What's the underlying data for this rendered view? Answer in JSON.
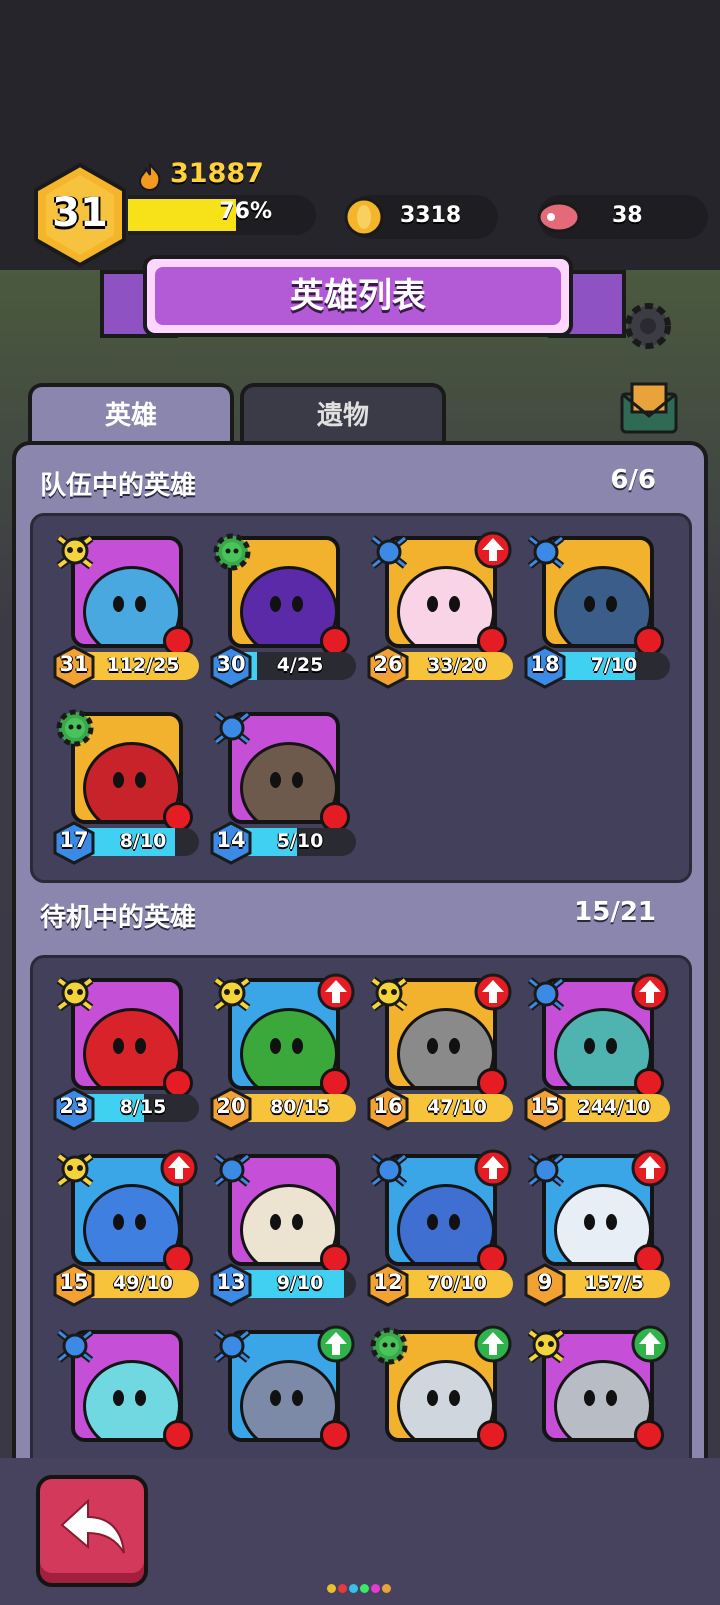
{
  "player": {
    "level": "31",
    "power": "31887",
    "xp_percent": 76,
    "xp_text": "76%"
  },
  "resources": {
    "coins": "3318",
    "meat": "38"
  },
  "banner": {
    "title": "英雄列表"
  },
  "tabs": [
    {
      "label": "英雄",
      "active": true
    },
    {
      "label": "遗物",
      "active": false
    }
  ],
  "team": {
    "title": "队伍中的英雄",
    "count": "6/6",
    "heroes": [
      {
        "level": "31",
        "shards": "112/25",
        "class": "skull",
        "upgrade": false,
        "bg": "#c64fd8",
        "body": "#4aa8e0",
        "bar": "gold",
        "fill": 1.0,
        "lvcolor": "gold"
      },
      {
        "level": "30",
        "shards": "4/25",
        "class": "gear",
        "upgrade": false,
        "bg": "#f3b22e",
        "body": "#5b2aa8",
        "bar": "cyan",
        "fill": 0.16,
        "lvcolor": "blue"
      },
      {
        "level": "26",
        "shards": "33/20",
        "class": "bug",
        "upgrade": true,
        "bg": "#f3b22e",
        "body": "#f9d4e6",
        "bar": "gold",
        "fill": 1.0,
        "lvcolor": "gold"
      },
      {
        "level": "18",
        "shards": "7/10",
        "class": "bug",
        "upgrade": false,
        "bg": "#f3b22e",
        "body": "#3b5d8a",
        "bar": "cyan",
        "fill": 0.7,
        "lvcolor": "blue"
      },
      {
        "level": "17",
        "shards": "8/10",
        "class": "gear",
        "upgrade": false,
        "bg": "#f3b22e",
        "body": "#c8232a",
        "bar": "cyan",
        "fill": 0.8,
        "lvcolor": "blue"
      },
      {
        "level": "14",
        "shards": "5/10",
        "class": "bug",
        "upgrade": false,
        "bg": "#c64fd8",
        "body": "#6e5a4c",
        "bar": "cyan",
        "fill": 0.5,
        "lvcolor": "blue"
      }
    ]
  },
  "bench": {
    "title": "待机中的英雄",
    "count": "15/21",
    "heroes": [
      {
        "level": "23",
        "shards": "8/15",
        "class": "skull",
        "upgrade": false,
        "bg": "#c64fd8",
        "body": "#d8232a",
        "bar": "cyan",
        "fill": 0.53,
        "lvcolor": "blue"
      },
      {
        "level": "20",
        "shards": "80/15",
        "class": "skull",
        "upgrade": true,
        "bg": "#3aa6e8",
        "body": "#3aa83a",
        "bar": "gold",
        "fill": 1.0,
        "lvcolor": "gold"
      },
      {
        "level": "16",
        "shards": "47/10",
        "class": "skull",
        "upgrade": true,
        "bg": "#f3b22e",
        "body": "#8a8a8a",
        "bar": "gold",
        "fill": 1.0,
        "lvcolor": "gold"
      },
      {
        "level": "15",
        "shards": "244/10",
        "class": "bug",
        "upgrade": true,
        "bg": "#c64fd8",
        "body": "#4fb3b0",
        "bar": "gold",
        "fill": 1.0,
        "lvcolor": "gold"
      },
      {
        "level": "15",
        "shards": "49/10",
        "class": "skull",
        "upgrade": true,
        "bg": "#3aa6e8",
        "body": "#3f7fe0",
        "bar": "gold",
        "fill": 1.0,
        "lvcolor": "gold"
      },
      {
        "level": "13",
        "shards": "9/10",
        "class": "bug",
        "upgrade": false,
        "bg": "#c64fd8",
        "body": "#ece3d0",
        "bar": "cyan",
        "fill": 0.9,
        "lvcolor": "blue"
      },
      {
        "level": "12",
        "shards": "70/10",
        "class": "bug",
        "upgrade": true,
        "bg": "#3aa6e8",
        "body": "#3f6fd0",
        "bar": "gold",
        "fill": 1.0,
        "lvcolor": "gold"
      },
      {
        "level": "9",
        "shards": "157/5",
        "class": "bug",
        "upgrade": true,
        "bg": "#3aa6e8",
        "body": "#e8eef5",
        "bar": "gold",
        "fill": 1.0,
        "lvcolor": "gold"
      },
      {
        "level": "",
        "shards": "",
        "class": "bug",
        "upgrade": false,
        "bg": "#c64fd8",
        "body": "#6fd8e0",
        "bar": "none",
        "fill": 0,
        "lvcolor": "blue"
      },
      {
        "level": "",
        "shards": "",
        "class": "bug",
        "upgrade": "green",
        "bg": "#3aa6e8",
        "body": "#7c8aa8",
        "bar": "none",
        "fill": 0,
        "lvcolor": "blue"
      },
      {
        "level": "",
        "shards": "",
        "class": "gear",
        "upgrade": "green",
        "bg": "#f3b22e",
        "body": "#cfd6de",
        "bar": "none",
        "fill": 0,
        "lvcolor": "blue"
      },
      {
        "level": "",
        "shards": "",
        "class": "skull",
        "upgrade": "green",
        "bg": "#c64fd8",
        "body": "#b8bcc4",
        "bar": "none",
        "fill": 0,
        "lvcolor": "blue"
      }
    ]
  },
  "colors": {
    "gold_bar": "#f6c33a",
    "cyan_bar": "#3fd0f2",
    "gold_hex": "#f2a233",
    "blue_hex": "#3a8ae6"
  }
}
